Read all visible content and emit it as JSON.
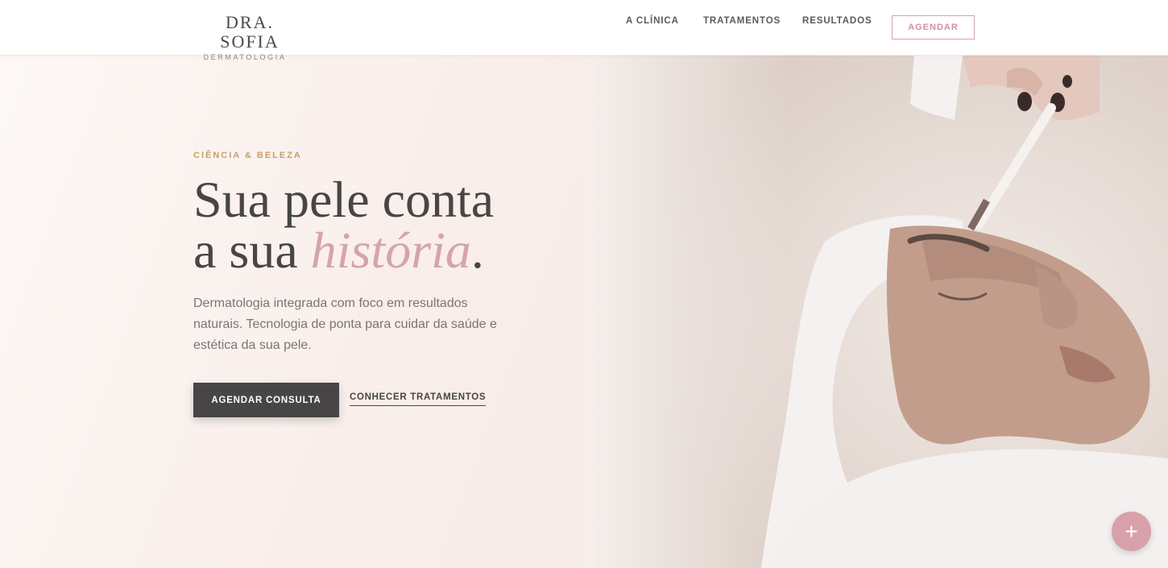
{
  "header": {
    "brand_name": "DRA. SOFIA",
    "brand_sub": "DERMATOLOGIA",
    "nav": [
      "A CLÍNICA",
      "TRATAMENTOS",
      "RESULTADOS"
    ],
    "cta": "AGENDAR"
  },
  "hero": {
    "eyebrow": "CIÊNCIA & BELEZA",
    "headline_line1": "Sua pele conta",
    "headline_line2_prefix": "a sua ",
    "headline_accent": "história",
    "headline_suffix": ".",
    "lead": "Dermatologia integrada com foco em resultados naturais. Tecnologia de ponta para cuidar da saúde e estética da sua pele.",
    "primary_button": "AGENDAR CONSULTA",
    "secondary_link": "CONHECER TRATAMENTOS",
    "image_icon": "spa-facial-treatment-photo"
  },
  "fab": {
    "icon": "plus-icon",
    "label": "+"
  },
  "colors": {
    "accent_pink": "#d4a4ad",
    "accent_gold": "#c7a168",
    "dark": "#474545",
    "background": "#fbf5f2"
  }
}
